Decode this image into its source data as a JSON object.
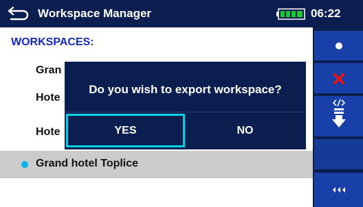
{
  "header": {
    "title": "Workspace Manager",
    "time": "06:22",
    "battery_level": 1.0,
    "back_icon": "back-arrow-icon",
    "battery_icon": "battery-icon"
  },
  "main": {
    "section_heading": "WORKSPACES:",
    "rows": [
      {
        "label": "Gran"
      },
      {
        "label": "Hote"
      },
      {
        "label": "Hote"
      },
      {
        "label": "Grand hotel Toplice"
      }
    ]
  },
  "dialog": {
    "message": "Do you wish to export workspace?",
    "yes_label": "YES",
    "no_label": "NO"
  },
  "sidebar": {
    "buttons": [
      {
        "icon": "dot-icon"
      },
      {
        "icon": "delete-x-icon"
      },
      {
        "icon": "export-icon"
      },
      {
        "icon": "blank"
      },
      {
        "icon": "more-options-icon"
      }
    ]
  },
  "colors": {
    "title_bar": "#0a1e50",
    "accent_blue": "#1428c8",
    "sidebar_button": "#1840a8",
    "selection_dot": "#00b4f0",
    "focus_cyan": "#00d2e6",
    "delete_red": "#e01414",
    "selected_row": "#cbcbcb"
  }
}
